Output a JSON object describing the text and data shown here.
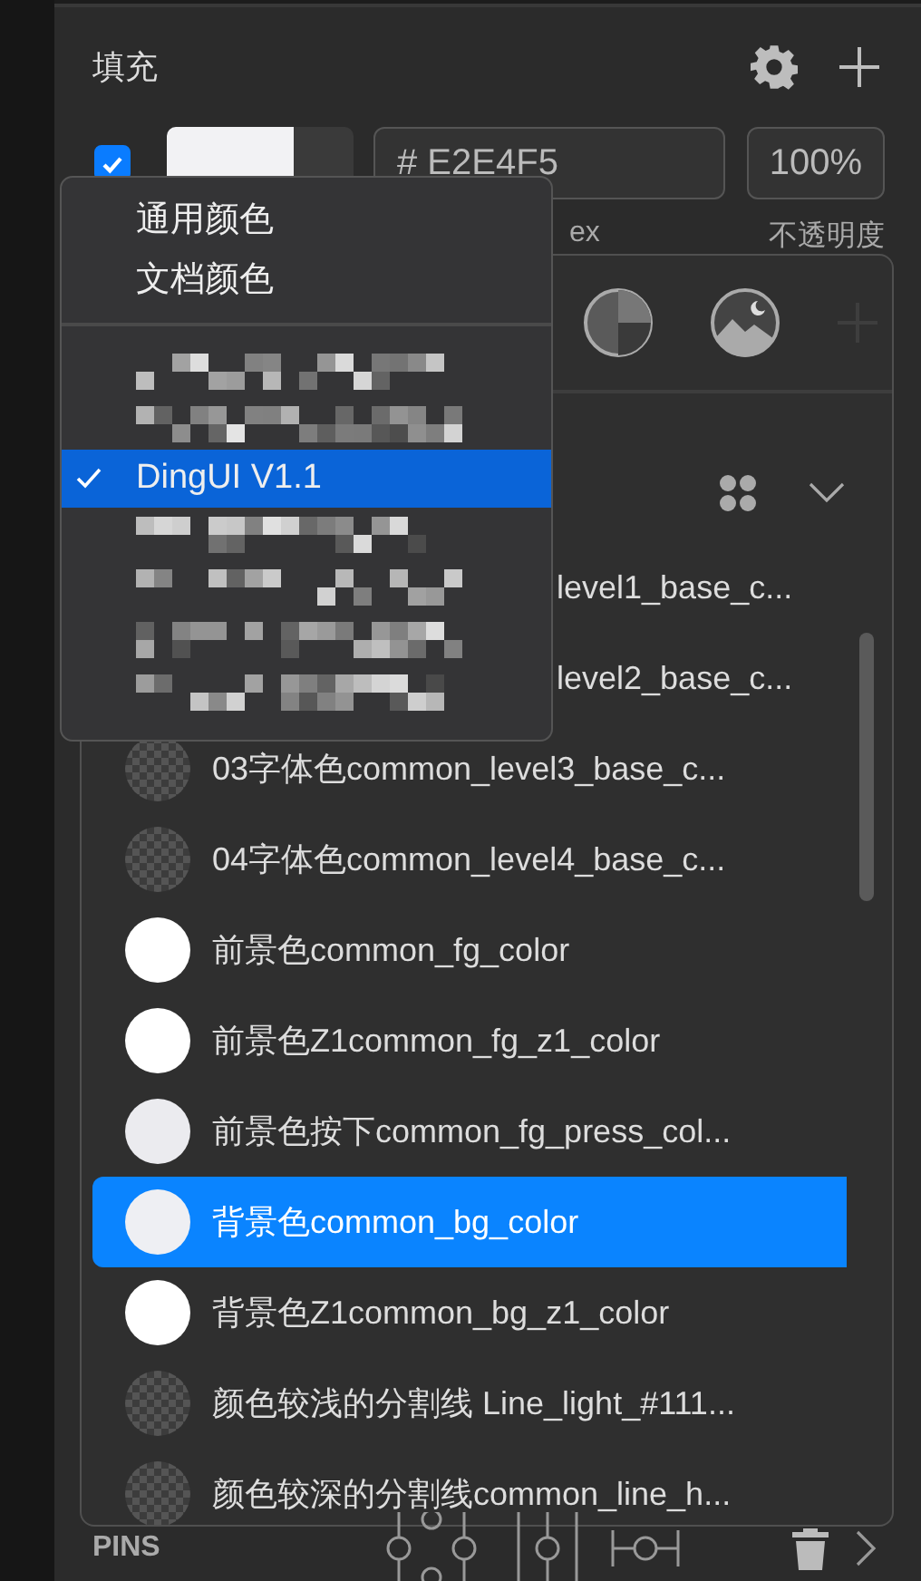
{
  "section": {
    "title": "填充"
  },
  "fill": {
    "checked": true,
    "hex": "# E2E4F5",
    "opacity": "100%"
  },
  "labels": {
    "hex_fragment": "ex",
    "opacity": "不透明度"
  },
  "menu": {
    "items": [
      {
        "kind": "text",
        "label": "通用颜色",
        "selected": false
      },
      {
        "kind": "text",
        "label": "文档颜色",
        "selected": false
      },
      {
        "kind": "divider"
      },
      {
        "kind": "redacted",
        "selected": false
      },
      {
        "kind": "redacted",
        "selected": false
      },
      {
        "kind": "text",
        "label": "DingUI V1.1",
        "selected": true
      },
      {
        "kind": "redacted",
        "selected": false
      },
      {
        "kind": "redacted",
        "selected": false
      },
      {
        "kind": "redacted",
        "selected": false
      },
      {
        "kind": "redacted",
        "selected": false
      }
    ]
  },
  "colors": [
    {
      "name": "level1_base_c...",
      "kind": "covered",
      "selected": false
    },
    {
      "name": "level2_base_c...",
      "kind": "covered",
      "selected": false
    },
    {
      "name": "03字体色common_level3_base_c...",
      "kind": "checker",
      "selected": false
    },
    {
      "name": "04字体色common_level4_base_c...",
      "kind": "checker",
      "selected": false
    },
    {
      "name": "前景色common_fg_color",
      "kind": "solid",
      "color": "#ffffff",
      "selected": false
    },
    {
      "name": "前景色Z1common_fg_z1_color",
      "kind": "solid",
      "color": "#ffffff",
      "selected": false
    },
    {
      "name": "前景色按下common_fg_press_col...",
      "kind": "solid",
      "color": "#ebebef",
      "selected": false
    },
    {
      "name": "背景色common_bg_color",
      "kind": "solid",
      "color": "#eeeff3",
      "selected": true
    },
    {
      "name": "背景色Z1common_bg_z1_color",
      "kind": "solid",
      "color": "#ffffff",
      "selected": false
    },
    {
      "name": "颜色较浅的分割线 Line_light_#111...",
      "kind": "checker",
      "selected": false
    },
    {
      "name": "颜色较深的分割线common_line_h...",
      "kind": "checker",
      "selected": false
    }
  ],
  "footer": {
    "title": "PINS"
  }
}
